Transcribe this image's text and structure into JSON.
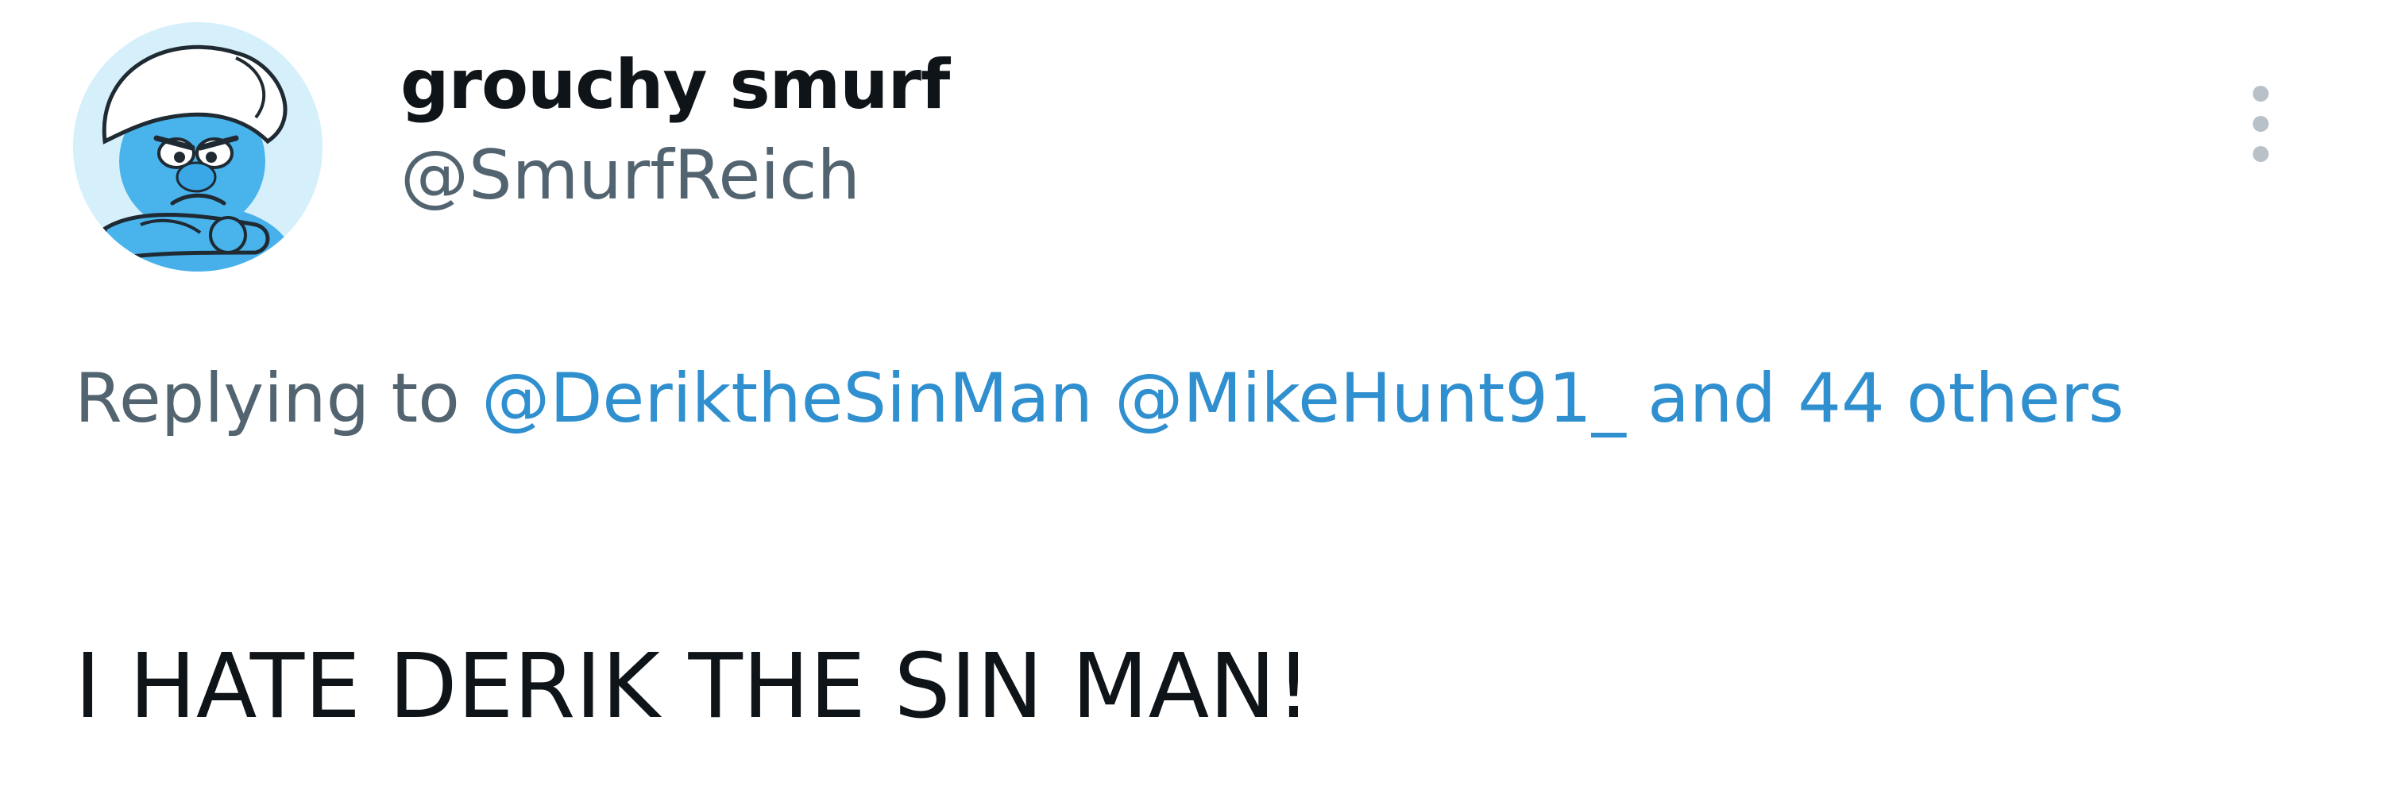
{
  "user": {
    "display_name": "grouchy smurf",
    "handle": "@SmurfReich",
    "avatar_icon": "grouchy-smurf-avatar"
  },
  "menu": {
    "icon": "more-vertical-icon"
  },
  "reply_context": {
    "prefix": "Replying to",
    "mentions": [
      "@DeriktheSinMan",
      "@MikeHunt91_"
    ],
    "others_link": "and 44 others"
  },
  "tweet": {
    "text": "I HATE DERIK THE SIN MAN!"
  },
  "colors": {
    "text_primary": "#0f1419",
    "text_secondary": "#536471",
    "link": "#2f8fcf",
    "avatar_bg": "#d6f0fb",
    "smurf_blue": "#3aa7e6"
  }
}
